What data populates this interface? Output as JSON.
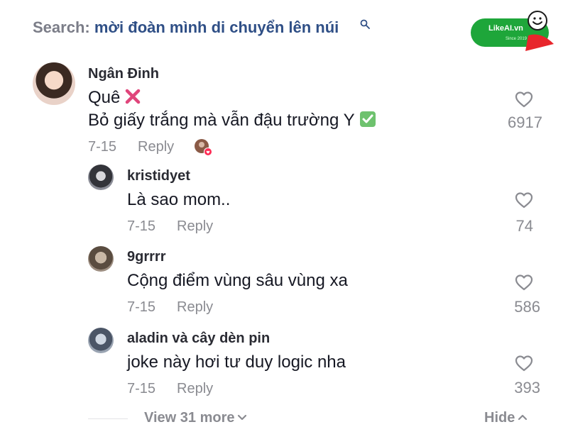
{
  "search": {
    "prefix": "Search:",
    "query": "mời đoàn mình di chuyển lên núi"
  },
  "watermark": {
    "brand": "LikeAI.vn",
    "tagline": "Since 2019",
    "accent_color": "#1ea63a"
  },
  "comments": [
    {
      "username": "Ngân Đinh",
      "lines": [
        "Quê",
        "Bỏ giấy trắng mà vẫn đậu trường Y"
      ],
      "line_icons": [
        "cross-mark-icon",
        "check-box-icon"
      ],
      "date": "7-15",
      "reply_label": "Reply",
      "likes": "6917",
      "creator_liked": true
    },
    {
      "username": "kristidyet",
      "lines": [
        "Là sao mom.."
      ],
      "date": "7-15",
      "reply_label": "Reply",
      "likes": "74"
    },
    {
      "username": "9grrrr",
      "lines": [
        "Cộng điểm vùng sâu vùng xa"
      ],
      "date": "7-15",
      "reply_label": "Reply",
      "likes": "586"
    },
    {
      "username": "aladin và cây dèn pin",
      "lines": [
        "joke này hơi tư duy logic nha"
      ],
      "date": "7-15",
      "reply_label": "Reply",
      "likes": "393"
    }
  ],
  "footer": {
    "view_more_label": "View 31 more",
    "hide_label": "Hide"
  },
  "colors": {
    "text_primary": "#161823",
    "text_secondary": "#8a8b91",
    "search_query": "#2f4f86",
    "cross_mark": "#e0457b",
    "check_box": "#6ec26e"
  }
}
